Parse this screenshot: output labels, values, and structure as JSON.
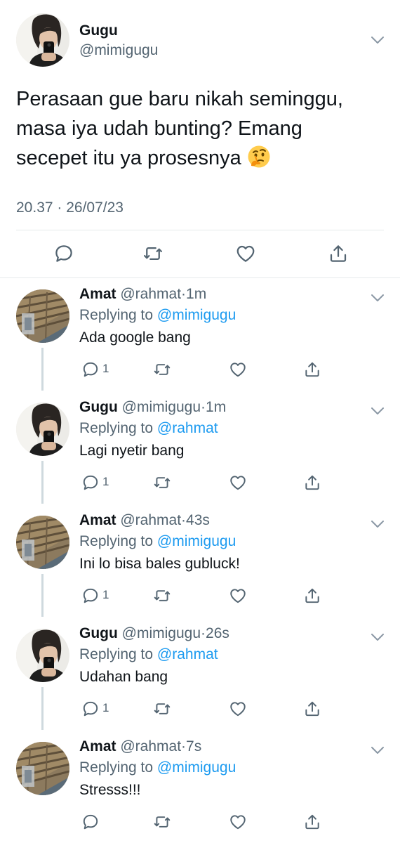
{
  "main_tweet": {
    "name": "Gugu",
    "handle": "@mimigugu",
    "text": "Perasaan gue baru nikah seminggu,\nmasa iya udah bunting? Emang\nsecepet itu ya prosesnya ",
    "emoji": "thinking-face-emoji",
    "timestamp": "20.37 · 26/07/23",
    "actions": [
      "reply-icon",
      "retweet-icon",
      "like-icon",
      "share-icon"
    ]
  },
  "replies": [
    {
      "name": "Amat",
      "handle": "@rahmat",
      "time": "1m",
      "replying_label": "Replying to",
      "replying_to": "@mimigugu",
      "text": "Ada google bang",
      "reply_count": "1",
      "avatar": "wall-avatar"
    },
    {
      "name": "Gugu",
      "handle": "@mimigugu",
      "time": "1m",
      "replying_label": "Replying to",
      "replying_to": "@rahmat",
      "text": "Lagi nyetir bang",
      "reply_count": "1",
      "avatar": "selfie-avatar"
    },
    {
      "name": "Amat",
      "handle": "@rahmat",
      "time": "43s",
      "replying_label": "Replying to",
      "replying_to": "@mimigugu",
      "text": "Ini lo bisa bales gubluck!",
      "reply_count": "1",
      "avatar": "wall-avatar"
    },
    {
      "name": "Gugu",
      "handle": "@mimigugu",
      "time": "26s",
      "replying_label": "Replying to",
      "replying_to": "@rahmat",
      "text": "Udahan bang",
      "reply_count": "1",
      "avatar": "selfie-avatar"
    },
    {
      "name": "Amat",
      "handle": "@rahmat",
      "time": "7s",
      "replying_label": "Replying to",
      "replying_to": "@mimigugu",
      "text": "Stresss!!!",
      "reply_count": "",
      "avatar": "wall-avatar"
    }
  ],
  "separator_dot": "·",
  "colors": {
    "text": "#0f1419",
    "secondary": "#536471",
    "link": "#1d9bf0",
    "divider": "#e6e9eb"
  }
}
